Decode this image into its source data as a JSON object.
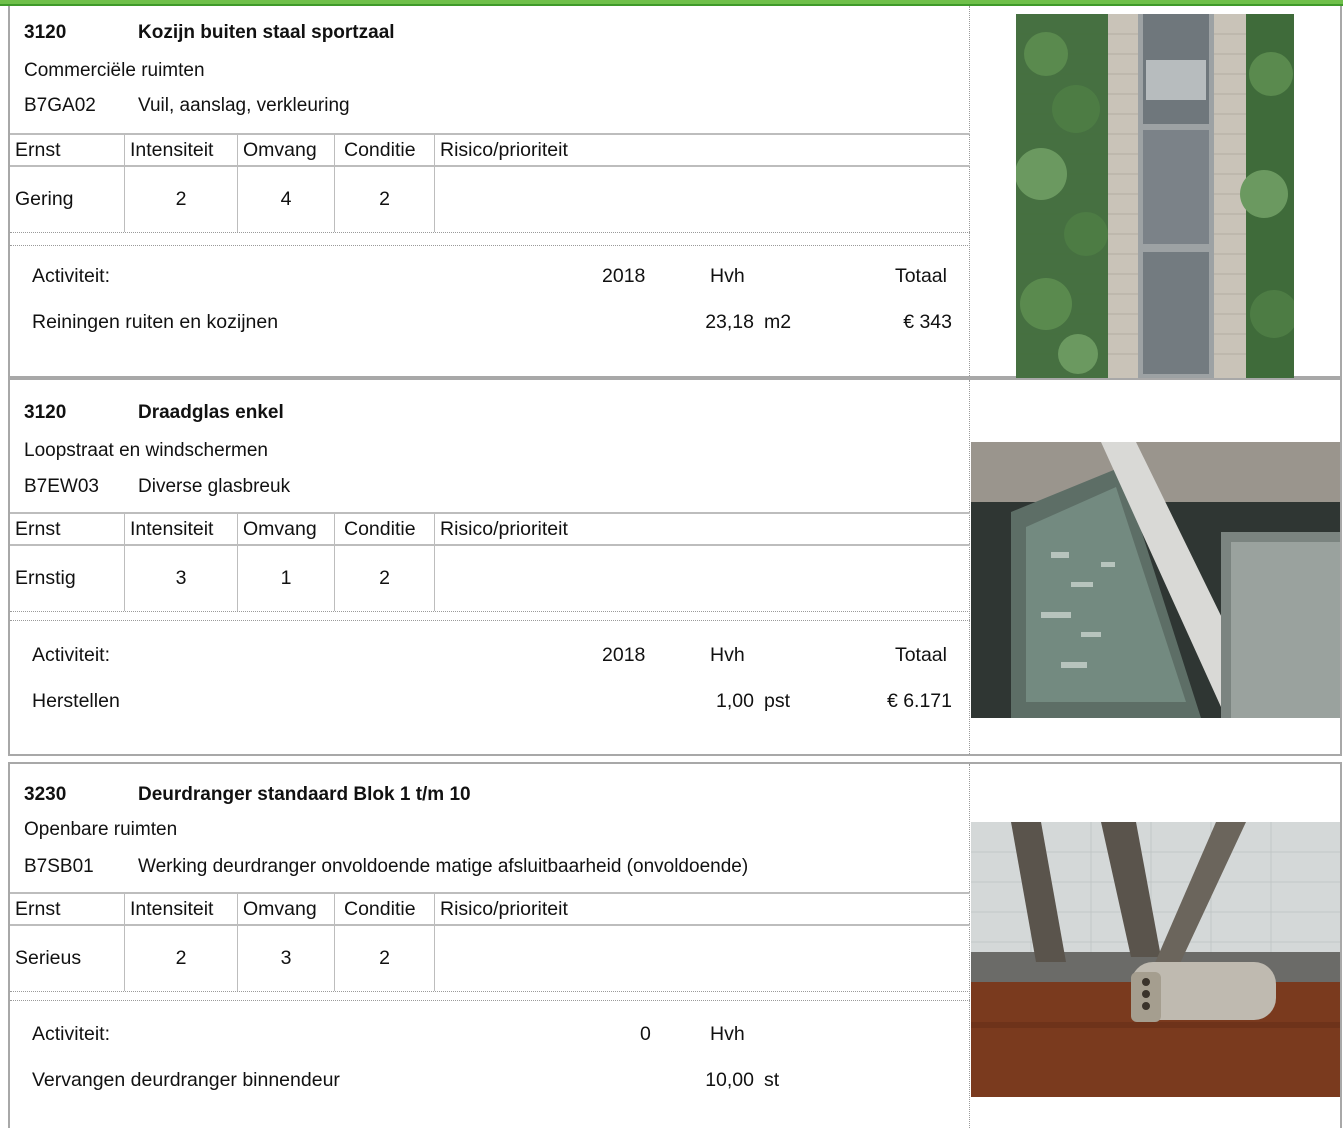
{
  "columns": {
    "ernst": "Ernst",
    "intensiteit": "Intensiteit",
    "omvang": "Omvang",
    "conditie": "Conditie",
    "risico": "Risico/prioriteit"
  },
  "activity_header": {
    "label": "Activiteit:",
    "unit_col": "Hvh",
    "total_col": "Totaal"
  },
  "items": [
    {
      "code": "3120",
      "title": "Kozijn buiten staal sportzaal",
      "location": "Commerciële ruimten",
      "defect_code": "B7GA02",
      "defect": "Vuil, aanslag, verkleuring",
      "ernst": "Gering",
      "intensiteit": "2",
      "omvang": "4",
      "conditie": "2",
      "risico": "",
      "year": "2018",
      "activity": "Reiningen ruiten en kozijnen",
      "quantity": "23,18",
      "unit": "m2",
      "total": "€ 343",
      "show_total_header": true
    },
    {
      "code": "3120",
      "title": "Draadglas enkel",
      "location": "Loopstraat en windschermen",
      "defect_code": "B7EW03",
      "defect": "Diverse glasbreuk",
      "ernst": "Ernstig",
      "intensiteit": "3",
      "omvang": "1",
      "conditie": "2",
      "risico": "",
      "year": "2018",
      "activity": "Herstellen",
      "quantity": "1,00",
      "unit": "pst",
      "total": "€ 6.171",
      "show_total_header": true
    },
    {
      "code": "3230",
      "title": "Deurdranger standaard Blok 1 t/m 10",
      "location": "Openbare ruimten",
      "defect_code": "B7SB01",
      "defect": "Werking deurdranger onvoldoende matige afsluitbaarheid (onvoldoende)",
      "ernst": "Serieus",
      "intensiteit": "2",
      "omvang": "3",
      "conditie": "2",
      "risico": "",
      "year": "0",
      "activity": "Vervangen deurdranger binnendeur",
      "quantity": "10,00",
      "unit": "st",
      "total": "",
      "show_total_header": false
    }
  ],
  "photos": [
    {
      "icon": "window-frame-photo",
      "colors": {
        "brick": "#c9c3b8",
        "ivy": "#3f6b3a",
        "glass": "#7b8288"
      }
    },
    {
      "icon": "wired-glass-photo",
      "colors": {
        "wall": "#8a867f",
        "pipe": "#d9d9d6",
        "glass": "#5d6e66"
      }
    },
    {
      "icon": "door-closer-photo",
      "colors": {
        "wood": "#7a3a1e",
        "glass": "#d4d8d8",
        "metal": "#bfbab0"
      }
    }
  ]
}
